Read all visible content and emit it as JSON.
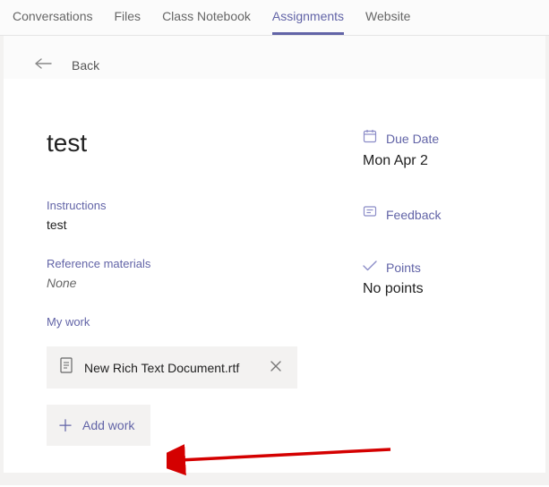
{
  "tabs": {
    "items": [
      {
        "label": "Conversations"
      },
      {
        "label": "Files"
      },
      {
        "label": "Class Notebook"
      },
      {
        "label": "Assignments"
      },
      {
        "label": "Website"
      }
    ],
    "activeIndex": 3
  },
  "back": {
    "label": "Back"
  },
  "assignment": {
    "title": "test",
    "instructions_label": "Instructions",
    "instructions_value": "test",
    "reference_label": "Reference materials",
    "reference_value": "None",
    "mywork_label": "My work",
    "work_file": "New Rich Text Document.rtf",
    "add_work_label": "Add work"
  },
  "side": {
    "due_label": "Due Date",
    "due_value": "Mon Apr 2",
    "feedback_label": "Feedback",
    "points_label": "Points",
    "points_value": "No points"
  }
}
